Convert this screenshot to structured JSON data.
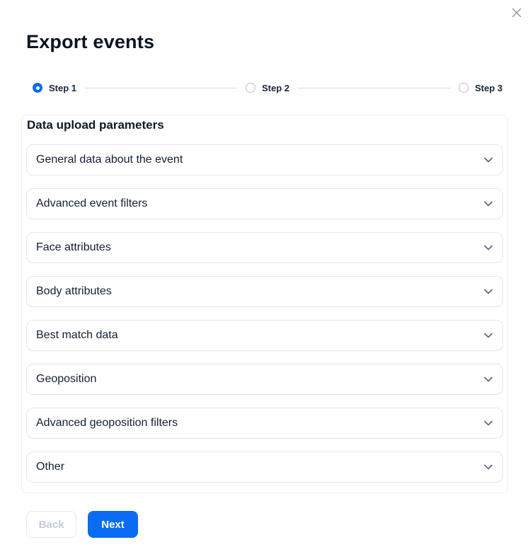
{
  "modal": {
    "title": "Export events"
  },
  "stepper": {
    "steps": [
      {
        "label": "Step 1",
        "state": "active"
      },
      {
        "label": "Step 2",
        "state": "inactive"
      },
      {
        "label": "Step 3",
        "state": "inactive"
      }
    ]
  },
  "section": {
    "heading": "Data upload parameters",
    "accordions": [
      {
        "label": "General data about the event",
        "expanded": false
      },
      {
        "label": "Advanced event filters",
        "expanded": false
      },
      {
        "label": "Face attributes",
        "expanded": false
      },
      {
        "label": "Body attributes",
        "expanded": false
      },
      {
        "label": "Best match data",
        "expanded": false
      },
      {
        "label": "Geoposition",
        "expanded": false
      },
      {
        "label": "Advanced geoposition filters",
        "expanded": false
      },
      {
        "label": "Other",
        "expanded": false
      }
    ]
  },
  "footer": {
    "back_label": "Back",
    "next_label": "Next",
    "back_disabled": true
  },
  "icons": {
    "close": "close-icon",
    "chevron": "chevron-down-icon"
  },
  "colors": {
    "accent_blue": "#0a6cf3",
    "text_dark": "#0c1423",
    "border_light": "#e2e6ec",
    "stepper_line": "#d6dbe2",
    "chevron": "#5d6b82",
    "disabled_text": "#c4cbd7"
  }
}
